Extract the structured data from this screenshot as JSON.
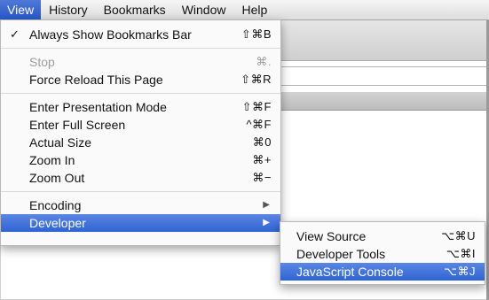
{
  "menubar": {
    "items": [
      "View",
      "History",
      "Bookmarks",
      "Window",
      "Help"
    ],
    "active_index": 0
  },
  "view_menu": {
    "always_show_bookmarks": {
      "label": "Always Show Bookmarks Bar",
      "shortcut": "⇧⌘B",
      "checked": "✓"
    },
    "stop": {
      "label": "Stop",
      "shortcut": "⌘."
    },
    "force_reload": {
      "label": "Force Reload This Page",
      "shortcut": "⇧⌘R"
    },
    "presentation": {
      "label": "Enter Presentation Mode",
      "shortcut": "⇧⌘F"
    },
    "full_screen": {
      "label": "Enter Full Screen",
      "shortcut": "^⌘F"
    },
    "actual_size": {
      "label": "Actual Size",
      "shortcut": "⌘0"
    },
    "zoom_in": {
      "label": "Zoom In",
      "shortcut": "⌘+"
    },
    "zoom_out": {
      "label": "Zoom Out",
      "shortcut": "⌘−"
    },
    "encoding": {
      "label": "Encoding",
      "arrow": "▶"
    },
    "developer": {
      "label": "Developer",
      "arrow": "▶"
    }
  },
  "developer_menu": {
    "view_source": {
      "label": "View Source",
      "shortcut": "⌥⌘U"
    },
    "developer_tools": {
      "label": "Developer Tools",
      "shortcut": "⌥⌘I"
    },
    "javascript_console": {
      "label": "JavaScript Console",
      "shortcut": "⌥⌘J"
    }
  },
  "colors": {
    "highlight": "#2f64d3",
    "menu_bg": "#fafafa",
    "disabled": "#9d9d9d"
  }
}
